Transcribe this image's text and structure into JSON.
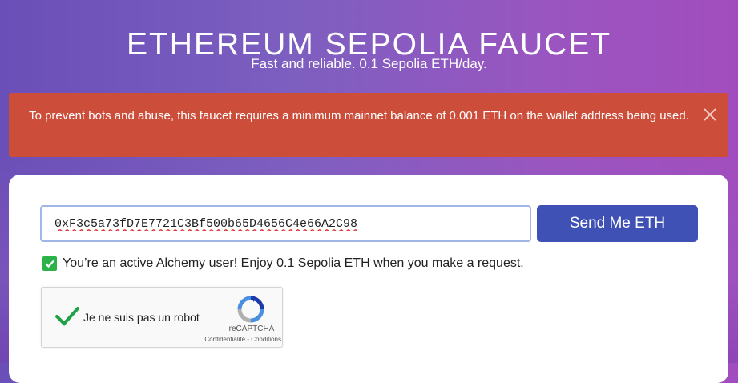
{
  "header": {
    "title": "ETHEREUM SEPOLIA FAUCET",
    "subtitle": "Fast and reliable. 0.1 Sepolia ETH/day."
  },
  "alert": {
    "message": "To prevent bots and abuse, this faucet requires a minimum mainnet balance of 0.001 ETH on the wallet address being used.",
    "close_icon": "close-icon"
  },
  "form": {
    "wallet_address": "0xF3c5a73fD7E7721C3Bf500b65D4656C4e66A2C98",
    "send_label": "Send Me ETH",
    "notice": "You’re an active Alchemy user! Enjoy 0.1 Sepolia ETH when you make a request."
  },
  "captcha": {
    "label": "Je ne suis pas un robot",
    "brand": "reCAPTCHA",
    "links": "Confidentialité - Conditions"
  },
  "colors": {
    "alert_bg": "#cc4d3a",
    "button_bg": "#3f51b5",
    "check_green": "#2bb34a"
  }
}
